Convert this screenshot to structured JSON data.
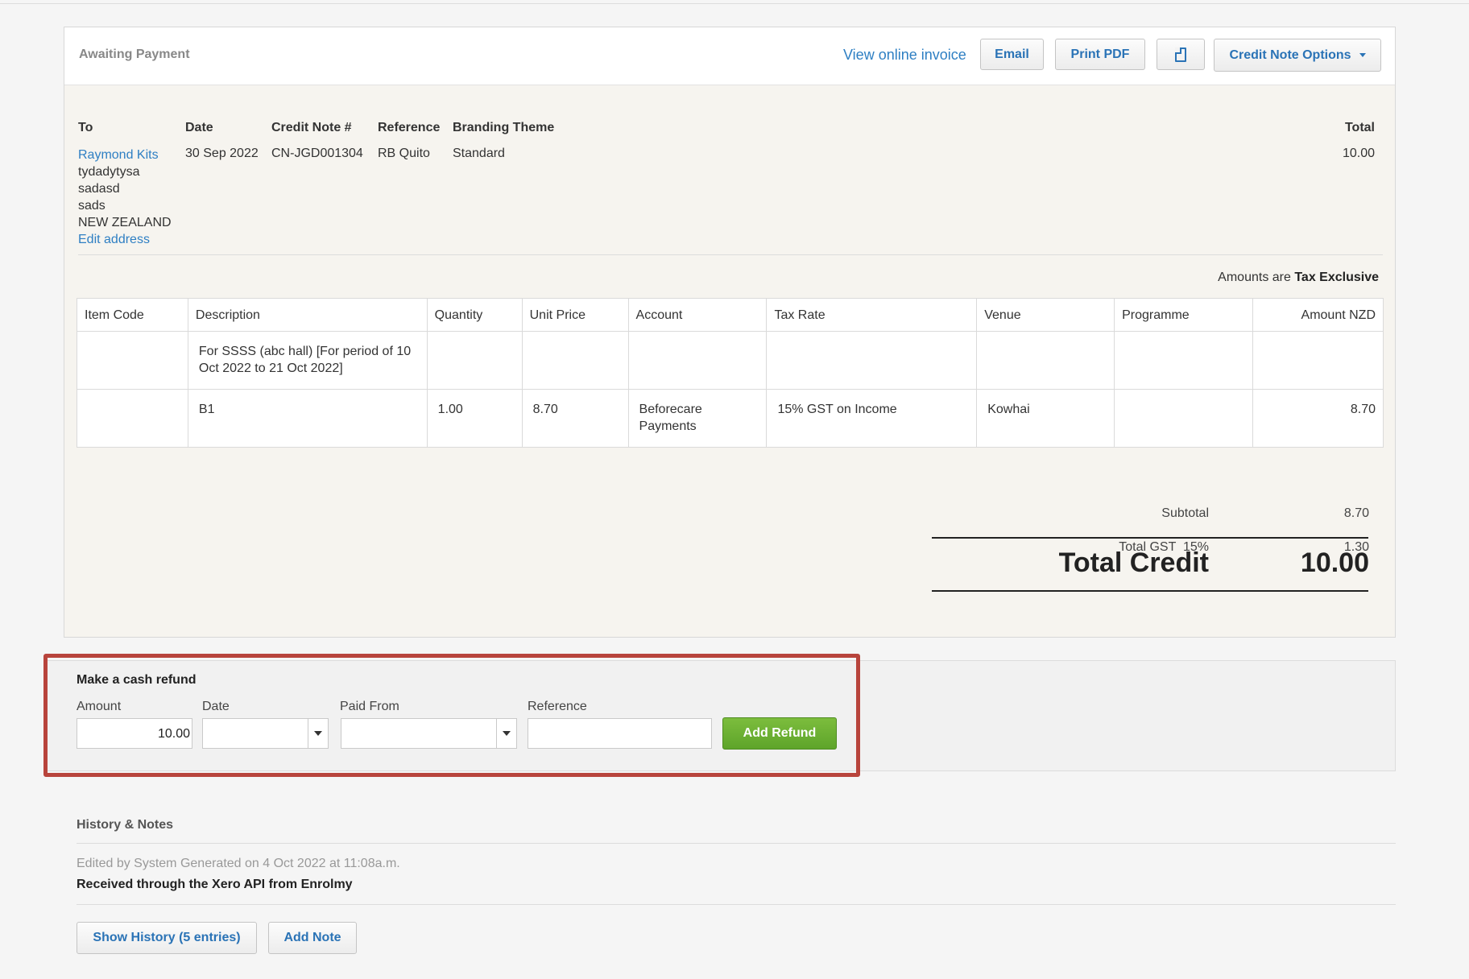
{
  "header": {
    "status": "Awaiting Payment",
    "view_online": "View online invoice",
    "email": "Email",
    "print_pdf": "Print PDF",
    "options": "Credit Note Options"
  },
  "details": {
    "to_label": "To",
    "date_label": "Date",
    "number_label": "Credit Note #",
    "reference_label": "Reference",
    "branding_label": "Branding Theme",
    "total_label": "Total",
    "contact": "Raymond Kits",
    "address": [
      "tydadytysa",
      "sadasd",
      "sads",
      "NEW ZEALAND"
    ],
    "edit_address": "Edit address",
    "date": "30 Sep 2022",
    "number": "CN-JGD001304",
    "reference": "RB Quito",
    "branding": "Standard",
    "total": "10.00"
  },
  "tax_note": {
    "prefix": "Amounts are",
    "mode": "Tax Exclusive"
  },
  "table": {
    "headers": [
      "Item Code",
      "Description",
      "Quantity",
      "Unit Price",
      "Account",
      "Tax Rate",
      "Venue",
      "Programme",
      "Amount NZD"
    ],
    "rows": [
      [
        "",
        "For SSSS (abc hall) [For period of 10 Oct 2022 to 21 Oct 2022]",
        "",
        "",
        "",
        "",
        "",
        "",
        ""
      ],
      [
        "",
        "B1",
        "1.00",
        "8.70",
        "Beforecare Payments",
        "15% GST on Income",
        "Kowhai",
        "",
        "8.70"
      ]
    ]
  },
  "totals": {
    "subtotal_label": "Subtotal",
    "subtotal": "8.70",
    "gst_label": "Total GST  15%",
    "gst": "1.30",
    "total_label": "Total Credit",
    "total": "10.00"
  },
  "refund": {
    "title": "Make a cash refund",
    "amount_label": "Amount",
    "amount_value": "10.00",
    "date_label": "Date",
    "paid_from_label": "Paid From",
    "reference_label": "Reference",
    "add_button": "Add Refund"
  },
  "history": {
    "title": "History & Notes",
    "edited": "Edited by System Generated on 4 Oct 2022 at 11:08a.m.",
    "message": "Received through the Xero API from Enrolmy",
    "show_history": "Show History (5 entries)",
    "add_note": "Add Note"
  },
  "colors": {
    "link": "#2e7fc3",
    "green_button": "#6aae31",
    "highlight": "#b8443c"
  }
}
